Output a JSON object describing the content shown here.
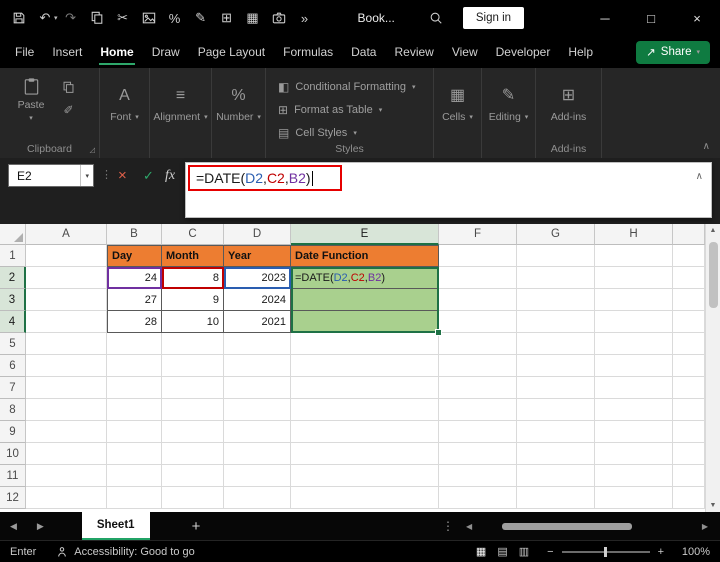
{
  "titlebar": {
    "workbook_name": "Book...",
    "signin_label": "Sign in",
    "icons": [
      "save",
      "undo",
      "redo",
      "copy",
      "cut",
      "picture",
      "percent",
      "draw",
      "insert-table",
      "table",
      "camera",
      "more-commands",
      "search",
      "minimize",
      "maximize",
      "close"
    ]
  },
  "menubar": {
    "items": [
      "File",
      "Insert",
      "Home",
      "Draw",
      "Page Layout",
      "Formulas",
      "Data",
      "Review",
      "View",
      "Developer",
      "Help"
    ],
    "active_item": "Home",
    "share_label": "Share"
  },
  "ribbon": {
    "paste_label": "Paste",
    "group_labels": {
      "clipboard": "Clipboard",
      "styles": "Styles",
      "addins": "Add-ins"
    },
    "buttons": {
      "font": "Font",
      "alignment": "Alignment",
      "number": "Number",
      "cells": "Cells",
      "editing": "Editing",
      "addins": "Add-ins"
    },
    "styles_items": [
      "Conditional Formatting",
      "Format as Table",
      "Cell Styles"
    ]
  },
  "formula_bar": {
    "name_box": "E2",
    "fx_label": "fx",
    "formula_parts": [
      {
        "text": "=DATE(",
        "color": "#1a1a1a"
      },
      {
        "text": "D2",
        "color": "#2A5DB0"
      },
      {
        "text": ",",
        "color": "#1a1a1a"
      },
      {
        "text": "C2",
        "color": "#C00000"
      },
      {
        "text": ",",
        "color": "#1a1a1a"
      },
      {
        "text": "B2",
        "color": "#7030A0"
      },
      {
        "text": ")",
        "color": "#1a1a1a"
      }
    ],
    "highlight_color": "#E60000"
  },
  "spreadsheet": {
    "column_headers": [
      "A",
      "B",
      "C",
      "D",
      "E",
      "F",
      "G",
      "H"
    ],
    "visible_rows": 12,
    "selected_column": "E",
    "selected_rows": [
      2,
      3,
      4
    ],
    "active_cell": "E2",
    "colors": {
      "table_header_fill": "#ED7D31",
      "result_fill": "#A9D08E",
      "selection_border": "#1E7145",
      "ref_blue": "#2A5DB0",
      "ref_red": "#C00000",
      "ref_purple": "#7030A0"
    },
    "cells": [
      {
        "ref": "B1",
        "value": "Day",
        "type": "table-header"
      },
      {
        "ref": "C1",
        "value": "Month",
        "type": "table-header"
      },
      {
        "ref": "D1",
        "value": "Year",
        "type": "table-header"
      },
      {
        "ref": "E1",
        "value": "Date Function",
        "type": "table-header"
      },
      {
        "ref": "B2",
        "value": "24",
        "type": "number",
        "ref_color": "#7030A0"
      },
      {
        "ref": "C2",
        "value": "8",
        "type": "number",
        "ref_color": "#C00000"
      },
      {
        "ref": "D2",
        "value": "2023",
        "type": "number",
        "ref_color": "#2A5DB0"
      },
      {
        "ref": "E2",
        "value": "=DATE(D2,C2,B2)",
        "type": "formula"
      },
      {
        "ref": "B3",
        "value": "27",
        "type": "number"
      },
      {
        "ref": "C3",
        "value": "9",
        "type": "number"
      },
      {
        "ref": "D3",
        "value": "2024",
        "type": "number"
      },
      {
        "ref": "E3",
        "value": "",
        "type": "green"
      },
      {
        "ref": "B4",
        "value": "28",
        "type": "number"
      },
      {
        "ref": "C4",
        "value": "10",
        "type": "number"
      },
      {
        "ref": "D4",
        "value": "2021",
        "type": "number"
      },
      {
        "ref": "E4",
        "value": "",
        "type": "green"
      }
    ]
  },
  "sheetbar": {
    "tabs": [
      {
        "label": "Sheet1",
        "active": true
      }
    ],
    "add_sheet_label": "+"
  },
  "statusbar": {
    "mode": "Enter",
    "accessibility": "Accessibility: Good to go",
    "zoom_level": "100%"
  }
}
